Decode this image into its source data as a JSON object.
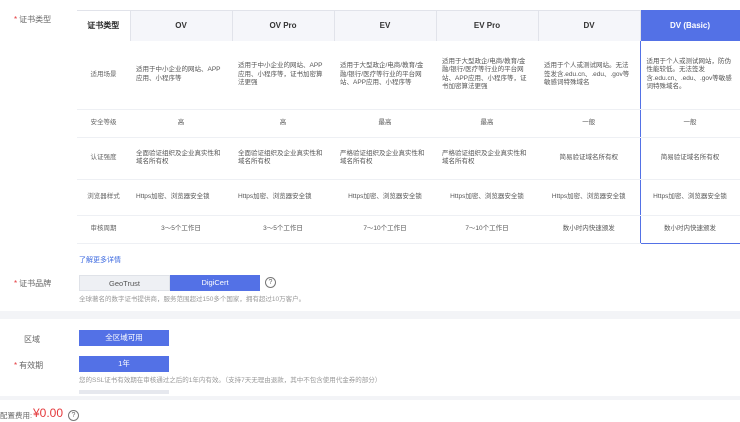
{
  "cert_type": {
    "label": "证书类型",
    "headers": [
      "证书类型",
      "OV",
      "OV Pro",
      "EV",
      "EV Pro",
      "DV",
      "DV (Basic)"
    ],
    "selected_index": 6,
    "rows": [
      {
        "name": "适用场景",
        "cells": [
          "适用于中小企业的网站、APP应用、小程序等",
          "适用于中小企业的网站、APP应用、小程序等，证书加密算法更强",
          "适用于大型政企/电商/教育/金融/银行/医疗等行业的平台网站、APP应用、小程序等",
          "适用于大型政企/电商/教育/金融/银行/医疗等行业的平台网站、APP应用、小程序等，证书加密算法更强",
          "适用于个人或测试网站。无法签发含.edu.cn、.edu、.gov等敏感词特殊域名",
          "适用于个人或测试网站，防伪性能较低。无法签发含.edu.cn、.edu、.gov等敏感词特殊域名。"
        ]
      },
      {
        "name": "安全等级",
        "cells": [
          "高",
          "高",
          "最高",
          "最高",
          "一般",
          "一般"
        ]
      },
      {
        "name": "认证强度",
        "cells": [
          "全面验证组织及企业真实性和域名所有权",
          "全面验证组织及企业真实性和域名所有权",
          "严格验证组织及企业真实性和域名所有权",
          "严格验证组织及企业真实性和域名所有权",
          "简易验证域名所有权",
          "简易验证域名所有权"
        ]
      },
      {
        "name": "浏览器样式",
        "cells": [
          "Https加密、浏览器安全锁",
          "Https加密、浏览器安全锁",
          "Https加密、浏览器安全锁",
          "Https加密、浏览器安全锁",
          "Https加密、浏览器安全锁",
          "Https加密、浏览器安全锁"
        ]
      },
      {
        "name": "审核周期",
        "cells": [
          "3～5个工作日",
          "3～5个工作日",
          "7～10个工作日",
          "7～10个工作日",
          "数小时内快速颁发",
          "数小时内快速颁发"
        ]
      }
    ],
    "more_link": "了解更多详情"
  },
  "brand": {
    "label": "证书品牌",
    "options": [
      "GeoTrust",
      "DigiCert"
    ],
    "selected": "DigiCert",
    "hint": "全球著名的数字证书提供商，服务范围超过150多个国家，拥有超过10万客户。"
  },
  "region": {
    "label": "区域",
    "value": "全区域可用"
  },
  "validity": {
    "label": "有效期",
    "value": "1年",
    "hint": "您的SSL证书有效期在审核通过之后的1年内有效。（支持7天无理由退款，其中不包含使用代金券的部分）"
  },
  "footer": {
    "fee_label": "配置费用:",
    "fee_value": "¥0.00"
  },
  "colors": {
    "accent": "#5371e6",
    "price": "#e4393c",
    "required": "#e4393c"
  }
}
